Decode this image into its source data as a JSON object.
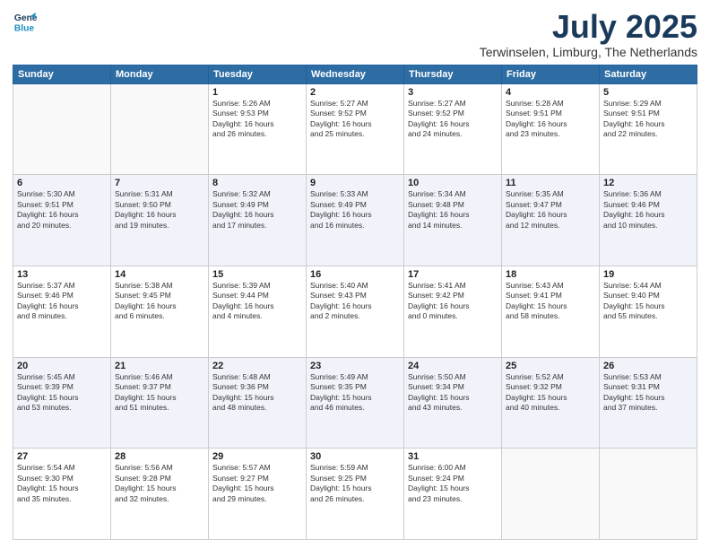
{
  "logo": {
    "line1": "General",
    "line2": "Blue"
  },
  "title": "July 2025",
  "subtitle": "Terwinselen, Limburg, The Netherlands",
  "headers": [
    "Sunday",
    "Monday",
    "Tuesday",
    "Wednesday",
    "Thursday",
    "Friday",
    "Saturday"
  ],
  "weeks": [
    [
      {
        "day": "",
        "info": ""
      },
      {
        "day": "",
        "info": ""
      },
      {
        "day": "1",
        "info": "Sunrise: 5:26 AM\nSunset: 9:53 PM\nDaylight: 16 hours\nand 26 minutes."
      },
      {
        "day": "2",
        "info": "Sunrise: 5:27 AM\nSunset: 9:52 PM\nDaylight: 16 hours\nand 25 minutes."
      },
      {
        "day": "3",
        "info": "Sunrise: 5:27 AM\nSunset: 9:52 PM\nDaylight: 16 hours\nand 24 minutes."
      },
      {
        "day": "4",
        "info": "Sunrise: 5:28 AM\nSunset: 9:51 PM\nDaylight: 16 hours\nand 23 minutes."
      },
      {
        "day": "5",
        "info": "Sunrise: 5:29 AM\nSunset: 9:51 PM\nDaylight: 16 hours\nand 22 minutes."
      }
    ],
    [
      {
        "day": "6",
        "info": "Sunrise: 5:30 AM\nSunset: 9:51 PM\nDaylight: 16 hours\nand 20 minutes."
      },
      {
        "day": "7",
        "info": "Sunrise: 5:31 AM\nSunset: 9:50 PM\nDaylight: 16 hours\nand 19 minutes."
      },
      {
        "day": "8",
        "info": "Sunrise: 5:32 AM\nSunset: 9:49 PM\nDaylight: 16 hours\nand 17 minutes."
      },
      {
        "day": "9",
        "info": "Sunrise: 5:33 AM\nSunset: 9:49 PM\nDaylight: 16 hours\nand 16 minutes."
      },
      {
        "day": "10",
        "info": "Sunrise: 5:34 AM\nSunset: 9:48 PM\nDaylight: 16 hours\nand 14 minutes."
      },
      {
        "day": "11",
        "info": "Sunrise: 5:35 AM\nSunset: 9:47 PM\nDaylight: 16 hours\nand 12 minutes."
      },
      {
        "day": "12",
        "info": "Sunrise: 5:36 AM\nSunset: 9:46 PM\nDaylight: 16 hours\nand 10 minutes."
      }
    ],
    [
      {
        "day": "13",
        "info": "Sunrise: 5:37 AM\nSunset: 9:46 PM\nDaylight: 16 hours\nand 8 minutes."
      },
      {
        "day": "14",
        "info": "Sunrise: 5:38 AM\nSunset: 9:45 PM\nDaylight: 16 hours\nand 6 minutes."
      },
      {
        "day": "15",
        "info": "Sunrise: 5:39 AM\nSunset: 9:44 PM\nDaylight: 16 hours\nand 4 minutes."
      },
      {
        "day": "16",
        "info": "Sunrise: 5:40 AM\nSunset: 9:43 PM\nDaylight: 16 hours\nand 2 minutes."
      },
      {
        "day": "17",
        "info": "Sunrise: 5:41 AM\nSunset: 9:42 PM\nDaylight: 16 hours\nand 0 minutes."
      },
      {
        "day": "18",
        "info": "Sunrise: 5:43 AM\nSunset: 9:41 PM\nDaylight: 15 hours\nand 58 minutes."
      },
      {
        "day": "19",
        "info": "Sunrise: 5:44 AM\nSunset: 9:40 PM\nDaylight: 15 hours\nand 55 minutes."
      }
    ],
    [
      {
        "day": "20",
        "info": "Sunrise: 5:45 AM\nSunset: 9:39 PM\nDaylight: 15 hours\nand 53 minutes."
      },
      {
        "day": "21",
        "info": "Sunrise: 5:46 AM\nSunset: 9:37 PM\nDaylight: 15 hours\nand 51 minutes."
      },
      {
        "day": "22",
        "info": "Sunrise: 5:48 AM\nSunset: 9:36 PM\nDaylight: 15 hours\nand 48 minutes."
      },
      {
        "day": "23",
        "info": "Sunrise: 5:49 AM\nSunset: 9:35 PM\nDaylight: 15 hours\nand 46 minutes."
      },
      {
        "day": "24",
        "info": "Sunrise: 5:50 AM\nSunset: 9:34 PM\nDaylight: 15 hours\nand 43 minutes."
      },
      {
        "day": "25",
        "info": "Sunrise: 5:52 AM\nSunset: 9:32 PM\nDaylight: 15 hours\nand 40 minutes."
      },
      {
        "day": "26",
        "info": "Sunrise: 5:53 AM\nSunset: 9:31 PM\nDaylight: 15 hours\nand 37 minutes."
      }
    ],
    [
      {
        "day": "27",
        "info": "Sunrise: 5:54 AM\nSunset: 9:30 PM\nDaylight: 15 hours\nand 35 minutes."
      },
      {
        "day": "28",
        "info": "Sunrise: 5:56 AM\nSunset: 9:28 PM\nDaylight: 15 hours\nand 32 minutes."
      },
      {
        "day": "29",
        "info": "Sunrise: 5:57 AM\nSunset: 9:27 PM\nDaylight: 15 hours\nand 29 minutes."
      },
      {
        "day": "30",
        "info": "Sunrise: 5:59 AM\nSunset: 9:25 PM\nDaylight: 15 hours\nand 26 minutes."
      },
      {
        "day": "31",
        "info": "Sunrise: 6:00 AM\nSunset: 9:24 PM\nDaylight: 15 hours\nand 23 minutes."
      },
      {
        "day": "",
        "info": ""
      },
      {
        "day": "",
        "info": ""
      }
    ]
  ]
}
